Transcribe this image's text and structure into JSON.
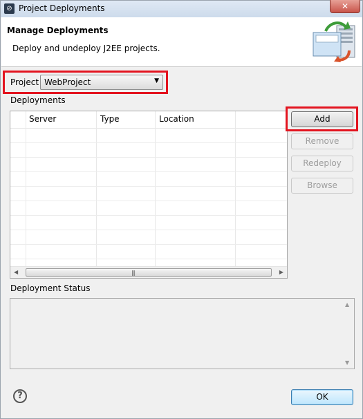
{
  "window": {
    "title": "Project Deployments",
    "close_glyph": "✕"
  },
  "banner": {
    "title": "Manage Deployments",
    "description": "Deploy and undeploy J2EE projects.",
    "icon": "deploy-server-icon"
  },
  "project": {
    "label": "Project",
    "selected": "WebProject"
  },
  "deployments": {
    "label": "Deployments",
    "columns": [
      "Server",
      "Type",
      "Location"
    ],
    "rows": []
  },
  "buttons": {
    "add": "Add",
    "remove": "Remove",
    "redeploy": "Redeploy",
    "browse": "Browse",
    "ok": "OK"
  },
  "status": {
    "label": "Deployment Status",
    "text": ""
  },
  "colors": {
    "highlight": "#e3141f",
    "ok_border": "#3c7fb1"
  }
}
